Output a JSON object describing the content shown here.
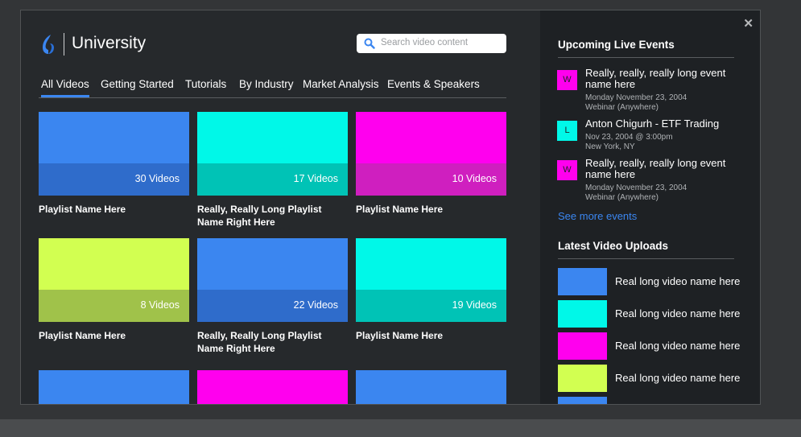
{
  "header": {
    "brand": "University"
  },
  "search": {
    "placeholder": "Search video content"
  },
  "tabs": [
    {
      "label": "All Videos",
      "active": true
    },
    {
      "label": "Getting Started"
    },
    {
      "label": "Tutorials"
    },
    {
      "label": "By Industry"
    },
    {
      "label": "Market Analysis"
    },
    {
      "label": "Events & Speakers"
    }
  ],
  "playlists": [
    {
      "count": "30 Videos",
      "name": "Playlist Name Here",
      "top": "#3b86f0",
      "bottom": "#2f6ccb"
    },
    {
      "count": "17 Videos",
      "name": "Really, Really Long Playlist Name Right Here",
      "top": "#00f8e8",
      "bottom": "#00c3b6"
    },
    {
      "count": "10 Videos",
      "name": "Playlist Name Here",
      "top": "#ff00ee",
      "bottom": "#cf1fbf"
    },
    {
      "count": "8 Videos",
      "name": "Playlist Name Here",
      "top": "#d2ff51",
      "bottom": "#a0c24a"
    },
    {
      "count": "22 Videos",
      "name": "Really, Really Long Playlist Name Right Here",
      "top": "#3b86f0",
      "bottom": "#2f6ccb"
    },
    {
      "count": "19 Videos",
      "name": "Playlist Name Here",
      "top": "#00f8e8",
      "bottom": "#00c3b6"
    },
    {
      "top": "#3b86f0",
      "bottom": "#2f6ccb"
    },
    {
      "top": "#ff00ee",
      "bottom": "#cf1fbf"
    },
    {
      "top": "#3b86f0",
      "bottom": "#2f6ccb"
    }
  ],
  "sidebar": {
    "events_title": "Upcoming Live Events",
    "events": [
      {
        "badge": "W",
        "color": "#ff00ee",
        "title": "Really, really, really long event name here",
        "line1": "Monday November 23, 2004",
        "line2": "Webinar (Anywhere)"
      },
      {
        "badge": "L",
        "color": "#00f8e8",
        "title": "Anton Chigurh - ETF Trading",
        "line1": "Nov 23, 2004 @ 3:00pm",
        "line2": "New York, NY"
      },
      {
        "badge": "W",
        "color": "#ff00ee",
        "title": "Really, really, really long event name here",
        "line1": "Monday November 23, 2004",
        "line2": "Webinar (Anywhere)"
      }
    ],
    "see_more": "See more events",
    "uploads_title": "Latest Video Uploads",
    "uploads": [
      {
        "name": "Real long video name here",
        "color": "#3b86f0"
      },
      {
        "name": "Real long video name here",
        "color": "#00f8e8"
      },
      {
        "name": "Real long video name here",
        "color": "#ff00ee"
      },
      {
        "name": "Real long video name here",
        "color": "#d2ff51"
      },
      {
        "name": "",
        "color": "#3b86f0"
      }
    ]
  },
  "colors": {
    "accent": "#3b86f0"
  }
}
